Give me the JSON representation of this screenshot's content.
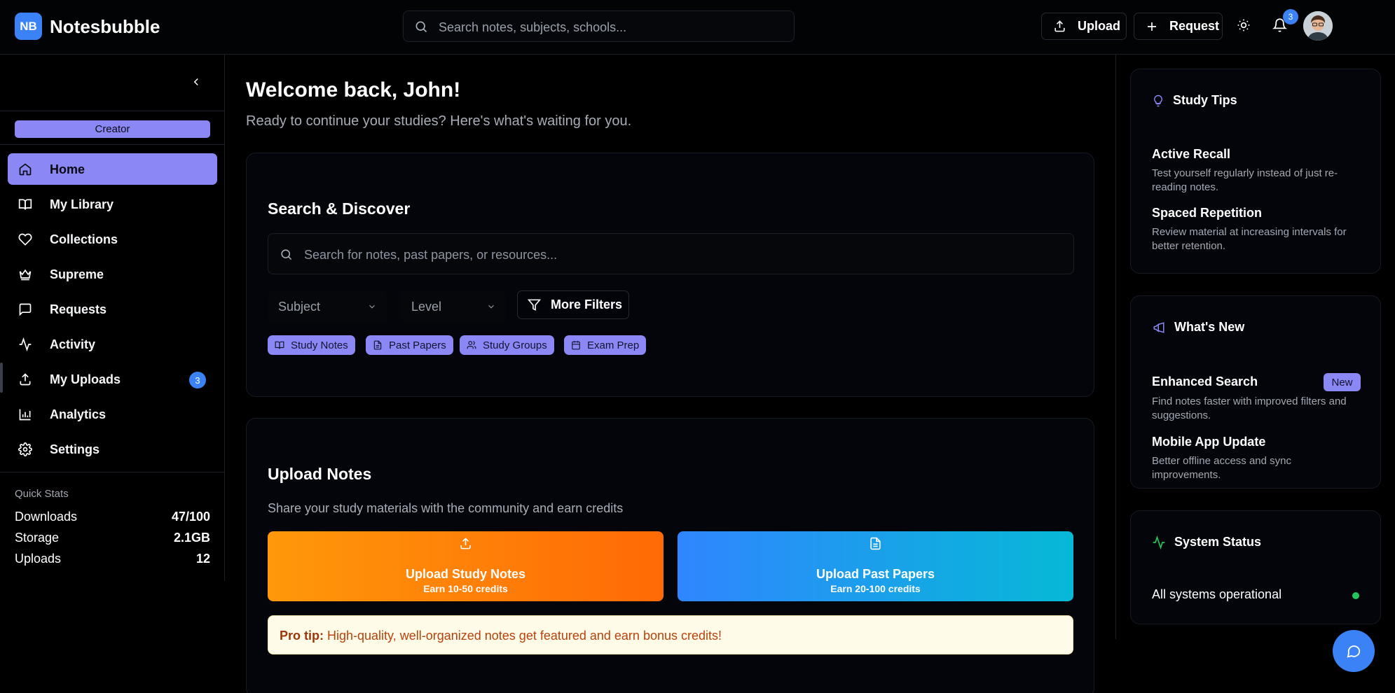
{
  "header": {
    "logo_text": "NB",
    "brand": "Notesbubble",
    "search_placeholder": "Search notes, subjects, schools...",
    "upload_label": "Upload",
    "request_label": "Request",
    "notification_count": "3"
  },
  "sidebar": {
    "role_badge": "Creator",
    "items": [
      {
        "label": "Home",
        "icon": "home-icon",
        "active": true
      },
      {
        "label": "My Library",
        "icon": "book-icon"
      },
      {
        "label": "Collections",
        "icon": "heart-icon"
      },
      {
        "label": "Supreme",
        "icon": "crown-icon"
      },
      {
        "label": "Requests",
        "icon": "message-icon"
      },
      {
        "label": "Activity",
        "icon": "activity-icon"
      },
      {
        "label": "My Uploads",
        "icon": "upload-icon",
        "badge": "3"
      },
      {
        "label": "Analytics",
        "icon": "bar-chart-icon"
      },
      {
        "label": "Settings",
        "icon": "gear-icon"
      }
    ],
    "quick_stats": {
      "title": "Quick Stats",
      "rows": [
        {
          "label": "Downloads",
          "value": "47/100"
        },
        {
          "label": "Storage",
          "value": "2.1GB"
        },
        {
          "label": "Uploads",
          "value": "12"
        }
      ]
    }
  },
  "main": {
    "welcome": "Welcome back, John!",
    "subtitle": "Ready to continue your studies? Here's what's waiting for you.",
    "search_card": {
      "title": "Search & Discover",
      "placeholder": "Search for notes, past papers, or resources...",
      "subject_select": "Subject",
      "level_select": "Level",
      "more_filters": "More Filters",
      "chips": [
        "Study Notes",
        "Past Papers",
        "Study Groups",
        "Exam Prep"
      ]
    },
    "upload_card": {
      "title": "Upload Notes",
      "description": "Share your study materials with the community and earn credits",
      "study_notes": {
        "title": "Upload Study Notes",
        "subtitle": "Earn 10-50 credits"
      },
      "past_papers": {
        "title": "Upload Past Papers",
        "subtitle": "Earn 20-100 credits"
      },
      "pro_tip_label": "Pro tip:",
      "pro_tip_text": " High-quality, well-organized notes get featured and earn bonus credits!"
    }
  },
  "right_rail": {
    "study_tips": {
      "title": "Study Tips",
      "items": [
        {
          "title": "Active Recall",
          "desc": "Test yourself regularly instead of just re-reading notes."
        },
        {
          "title": "Spaced Repetition",
          "desc": "Review material at increasing intervals for better retention."
        }
      ]
    },
    "whats_new": {
      "title": "What's New",
      "items": [
        {
          "title": "Enhanced Search",
          "badge": "New",
          "desc": "Find notes faster with improved filters and suggestions."
        },
        {
          "title": "Mobile App Update",
          "desc": "Better offline access and sync improvements."
        }
      ]
    },
    "system_status": {
      "title": "System Status",
      "text": "All systems operational",
      "status_color": "#22c55e"
    }
  },
  "colors": {
    "accent": "#8b87f5",
    "primary": "#3b82f6",
    "orange_start": "#ff980a",
    "orange_end": "#ff6a06",
    "blue_start": "#2f86ff",
    "blue_end": "#06b9d6"
  }
}
